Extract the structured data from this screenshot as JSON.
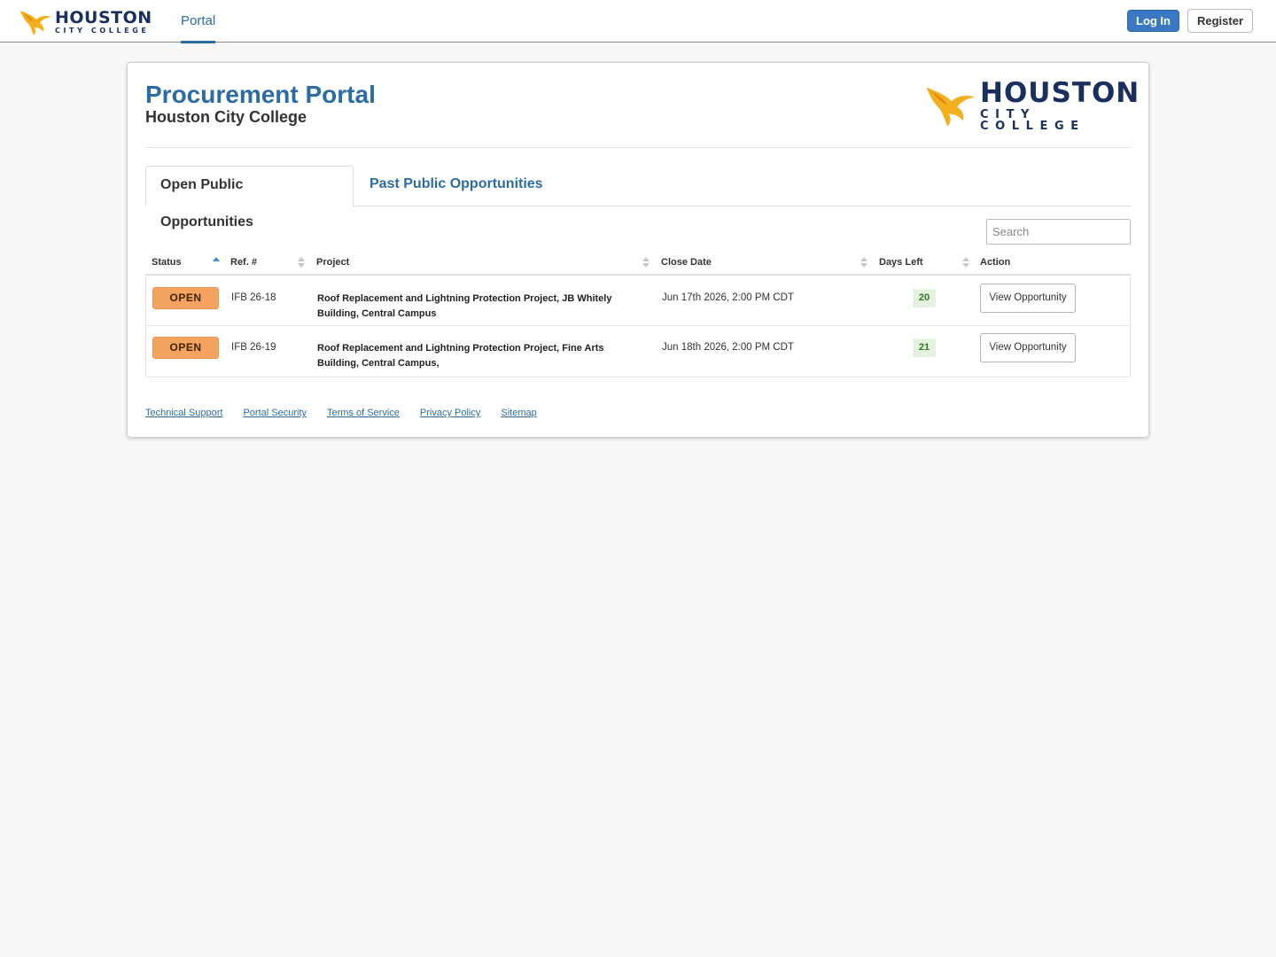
{
  "topbar": {
    "brand": {
      "name": "HOUSTON",
      "sub": "CITY COLLEGE"
    },
    "nav_portal": "Portal",
    "login_label": "Log In",
    "register_label": "Register"
  },
  "card": {
    "title": "Procurement Portal",
    "subtitle": "Houston City College",
    "brand": {
      "name": "HOUSTON",
      "sub": "CITY COLLEGE"
    }
  },
  "tabs": {
    "open": "Open Public Opportunities",
    "past": "Past Public Opportunities"
  },
  "search": {
    "placeholder": "Search"
  },
  "table": {
    "headers": {
      "status": "Status",
      "ref": "Ref. #",
      "project": "Project",
      "close_date": "Close Date",
      "days_left": "Days Left",
      "action": "Action"
    },
    "rows": [
      {
        "status": "OPEN",
        "ref": "IFB 26-18",
        "project": "Roof Replacement and Lightning Protection Project, JB Whitely Building, Central Campus",
        "close_date": "Jun 17th 2026, 2:00 PM CDT",
        "days_left": "20",
        "action": "View Opportunity"
      },
      {
        "status": "OPEN",
        "ref": "IFB 26-19",
        "project": "Roof Replacement and Lightning Protection Project, Fine Arts Building, Central Campus,",
        "close_date": "Jun 18th 2026, 2:00 PM CDT",
        "days_left": "21",
        "action": "View Opportunity"
      }
    ]
  },
  "footer": {
    "links": [
      "Technical Support",
      "Portal Security",
      "Terms of Service",
      "Privacy Policy",
      "Sitemap"
    ]
  },
  "colors": {
    "accent": "#2d6ca2",
    "login_button": "#3a78c3",
    "status_open": "#f4a460",
    "days_badge_bg": "#e4f2df",
    "brand_navy": "#1b2f5e",
    "brand_gold": "#f2b01e"
  }
}
